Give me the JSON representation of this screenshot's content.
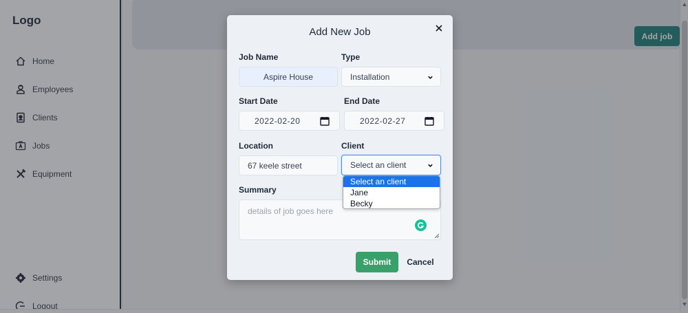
{
  "sidebar": {
    "logo": "Logo",
    "items": [
      {
        "label": "Home",
        "icon": "home-icon"
      },
      {
        "label": "Employees",
        "icon": "employee-icon"
      },
      {
        "label": "Clients",
        "icon": "client-icon"
      },
      {
        "label": "Jobs",
        "icon": "jobs-icon"
      },
      {
        "label": "Equipment",
        "icon": "tools-icon"
      }
    ],
    "bottom_items": [
      {
        "label": "Settings",
        "icon": "gear-icon"
      },
      {
        "label": "Logout",
        "icon": "logout-icon"
      }
    ]
  },
  "main": {
    "add_job_label": "Add job"
  },
  "modal": {
    "title": "Add New Job",
    "job_name": {
      "label": "Job Name",
      "value": "Aspire House"
    },
    "type": {
      "label": "Type",
      "value": "Installation"
    },
    "start_date": {
      "label": "Start Date",
      "value": "2022-02-20"
    },
    "end_date": {
      "label": "End Date",
      "value": "2022-02-27"
    },
    "location": {
      "label": "Location",
      "value": "67 keele street"
    },
    "client": {
      "label": "Client",
      "value": "Select an client",
      "options": [
        "Select an client",
        "Jane",
        "Becky"
      ]
    },
    "summary": {
      "label": "Summary",
      "placeholder": "details of job goes here"
    },
    "submit_label": "Submit",
    "cancel_label": "Cancel"
  },
  "colors": {
    "accent_teal": "#0f766e",
    "submit_green": "#38a169",
    "selected_option": "#1a73e8",
    "grammarly": "#15c39a"
  }
}
